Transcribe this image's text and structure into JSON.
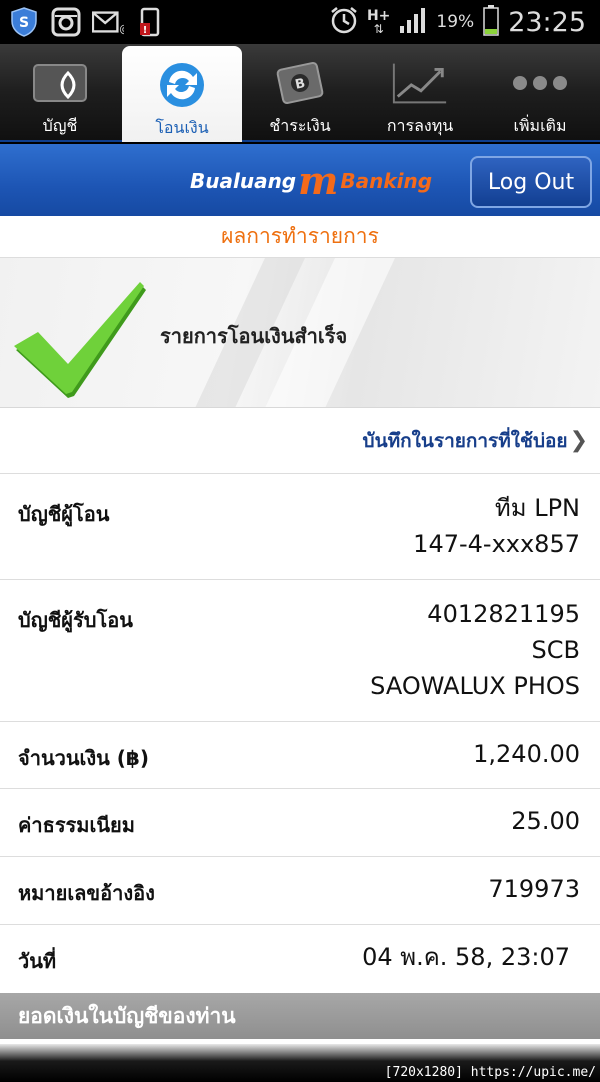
{
  "status_bar": {
    "battery_percent": "19%",
    "time": "23:25",
    "network": "H+",
    "icons": [
      "shield-icon",
      "instagram-icon",
      "mail-icon",
      "sim-alert-icon",
      "alarm-icon",
      "network-icon",
      "signal-icon",
      "battery-icon"
    ]
  },
  "tabs": [
    {
      "label": "บัญชี",
      "icon": "wallet-icon",
      "active": false
    },
    {
      "label": "โอนเงิน",
      "icon": "transfer-icon",
      "active": true
    },
    {
      "label": "ชำระเงิน",
      "icon": "bill-pay-icon",
      "active": false
    },
    {
      "label": "การลงทุน",
      "icon": "chart-icon",
      "active": false
    },
    {
      "label": "เพิ่มเติม",
      "icon": "more-icon",
      "active": false
    }
  ],
  "header": {
    "brand_left": "Bualuang",
    "brand_m": "m",
    "brand_right": "Banking",
    "logout_label": "Log Out"
  },
  "page": {
    "title": "ผลการทำรายการ",
    "success_message": "รายการโอนเงินสำเร็จ",
    "save_favorite": "บันทึกในรายการที่ใช้บ่อย"
  },
  "details": {
    "from_label": "บัญชีผู้โอน",
    "from_name": "ทีม LPN",
    "from_account": "147-4-xxx857",
    "to_label": "บัญชีผู้รับโอน",
    "to_account": "4012821195",
    "to_bank": "SCB",
    "to_name": "SAOWALUX PHOS",
    "amount_label": "จำนวนเงิน (฿)",
    "amount": "1,240.00",
    "fee_label": "ค่าธรรมเนียม",
    "fee": "25.00",
    "ref_label": "หมายเลขอ้างอิง",
    "ref": "719973",
    "date_label": "วันที่",
    "date": "04 พ.ค. 58, 23:07"
  },
  "balance_section": "ยอดเงินในบัญชีของท่าน",
  "watermark": "[720x1280] https://upic.me/",
  "colors": {
    "accent_orange": "#ee7010",
    "header_blue": "#1d55b4",
    "link_blue": "#173e8a",
    "check_green": "#5cc52a"
  }
}
